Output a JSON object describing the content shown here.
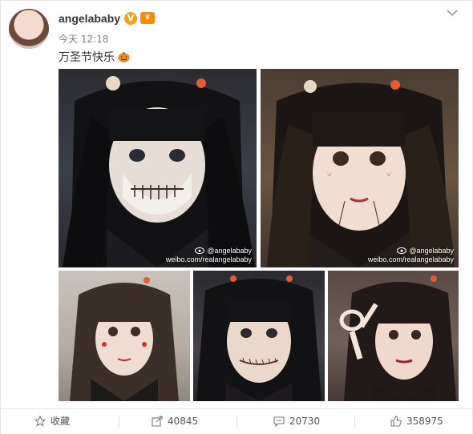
{
  "post": {
    "username": "angelababy",
    "timestamp": "今天 12:18",
    "text": "万圣节快乐",
    "verified_icon": "verified-v-icon",
    "rank_icon": "member-rank-icon"
  },
  "photos": [
    {
      "name": "photo-skull-makeup",
      "watermark_line1": "@angelababy",
      "watermark_line2": "weibo.com/realangelababy"
    },
    {
      "name": "photo-doll-makeup",
      "watermark_line1": "@angelababy",
      "watermark_line2": "weibo.com/realangelababy"
    },
    {
      "name": "photo-grey-doll"
    },
    {
      "name": "photo-stitched-mouth"
    },
    {
      "name": "photo-peace-sign"
    }
  ],
  "actions": {
    "favorite_label": "收藏",
    "repost_count": "40845",
    "comment_count": "20730",
    "like_count": "358975"
  },
  "colors": {
    "accent_orange": "#ff8a00",
    "text_dark": "#333333",
    "text_muted": "#808080"
  }
}
